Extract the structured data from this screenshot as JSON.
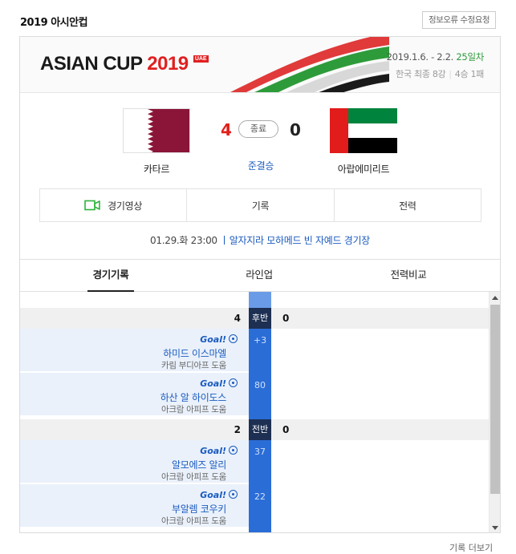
{
  "header": {
    "title": "2019 아시안컵",
    "report_button": "정보오류 수정요청"
  },
  "banner": {
    "logo_text": "ASIAN CUP",
    "logo_year": "2019",
    "logo_badge": "UAE",
    "dates": "2019.1.6. - 2.2.",
    "dday": "25일차",
    "stage": "한국 최종 8강",
    "record": "4승 1패"
  },
  "match": {
    "home_team": "카타르",
    "away_team": "아랍에미리트",
    "home_score": "4",
    "away_score": "0",
    "status": "종료",
    "result": "준결승",
    "datetime": "01.29.화 23:00",
    "stadium": "알자지라 모하메드 빈 자예드 경기장"
  },
  "media_tabs": [
    {
      "label": "경기영상",
      "icon": "video-camera-icon"
    },
    {
      "label": "기록"
    },
    {
      "label": "전력"
    }
  ],
  "section_tabs": [
    "경기기록",
    "라인업",
    "전력비교"
  ],
  "timeline": {
    "halves": [
      {
        "label": "후반",
        "home_score": "4",
        "away_score": "0",
        "events": [
          {
            "goal_label": "Goal!",
            "player": "하미드 이스마엘",
            "assist": "카림 부디아프 도움",
            "minute": "+3"
          },
          {
            "goal_label": "Goal!",
            "player": "하산 알 하이도스",
            "assist": "아크람 아피프 도움",
            "minute": "80"
          }
        ]
      },
      {
        "label": "전반",
        "home_score": "2",
        "away_score": "0",
        "events": [
          {
            "goal_label": "Goal!",
            "player": "알모에즈 알리",
            "assist": "아크람 아피프 도움",
            "minute": "37"
          },
          {
            "goal_label": "Goal!",
            "player": "부알렘 코우키",
            "assist": "아크람 아피프 도움",
            "minute": "22"
          }
        ]
      }
    ]
  },
  "colors": {
    "accent_blue": "#1b5bbf",
    "home_score_red": "#e0201c",
    "timeline_bar": "#2b6dd6",
    "half_label_bg": "#1d2f52",
    "dday_green": "#2e9b3a"
  },
  "footer": {
    "more_link": "기록 더보기"
  }
}
